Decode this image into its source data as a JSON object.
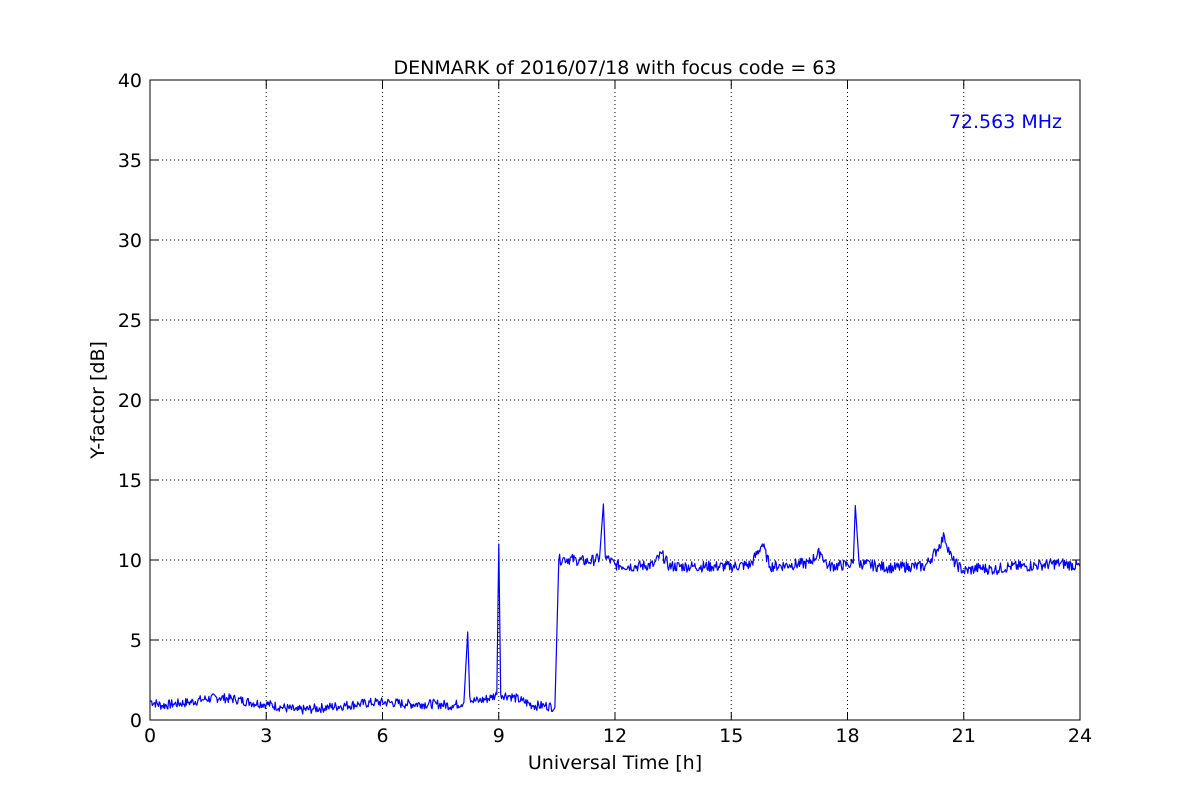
{
  "chart_data": {
    "type": "line",
    "title": "DENMARK of 2016/07/18 with focus code = 63",
    "xlabel": "Universal Time [h]",
    "ylabel": "Y-factor [dB]",
    "xlim": [
      0,
      24
    ],
    "ylim": [
      0,
      40
    ],
    "xticks": [
      0,
      3,
      6,
      9,
      12,
      15,
      18,
      21,
      24
    ],
    "yticks": [
      0,
      5,
      10,
      15,
      20,
      25,
      30,
      35,
      40
    ],
    "grid": true,
    "annotation": "72.563 MHz",
    "colors": {
      "series": "#0000ff",
      "annotation": "#0000ff",
      "grid": "#000000"
    },
    "series": [
      {
        "x": [
          0.0,
          0.3,
          0.6,
          1.0,
          1.4,
          1.8,
          2.2,
          2.6,
          3.0,
          3.4,
          3.8,
          4.2,
          4.6,
          5.0,
          5.4,
          5.8,
          6.2,
          6.6,
          7.0,
          7.4,
          7.8,
          8.1,
          8.2,
          8.25,
          8.3,
          8.5,
          8.8,
          8.95,
          9.0,
          9.05,
          9.3,
          9.6,
          9.9,
          10.2,
          10.45,
          10.55,
          10.7,
          11.0,
          11.3,
          11.6,
          11.7,
          11.75,
          12.0,
          12.5,
          13.0,
          13.2,
          13.4,
          14.0,
          14.5,
          15.0,
          15.5,
          15.8,
          16.0,
          16.5,
          17.0,
          17.3,
          17.5,
          18.0,
          18.15,
          18.2,
          18.3,
          18.8,
          19.2,
          19.6,
          20.0,
          20.3,
          20.5,
          20.7,
          21.0,
          21.4,
          21.8,
          22.2,
          22.6,
          23.0,
          23.5,
          24.0
        ],
        "y": [
          1.2,
          0.9,
          1.0,
          1.1,
          1.3,
          1.4,
          1.3,
          1.1,
          1.0,
          0.8,
          0.6,
          0.7,
          0.8,
          0.9,
          1.0,
          1.1,
          1.1,
          1.0,
          1.0,
          1.0,
          0.9,
          1.1,
          5.5,
          1.5,
          1.2,
          1.2,
          1.4,
          1.6,
          11.0,
          1.6,
          1.5,
          1.2,
          0.9,
          0.9,
          0.8,
          10.0,
          10.1,
          10.0,
          9.9,
          10.1,
          13.5,
          10.2,
          9.7,
          9.6,
          9.7,
          10.4,
          9.6,
          9.6,
          9.6,
          9.6,
          9.7,
          11.0,
          9.6,
          9.7,
          9.8,
          10.5,
          9.6,
          9.7,
          9.8,
          13.4,
          9.8,
          9.6,
          9.5,
          9.6,
          9.6,
          10.6,
          11.5,
          10.0,
          9.3,
          9.5,
          9.4,
          9.6,
          9.6,
          9.7,
          9.8,
          9.6
        ]
      }
    ]
  }
}
